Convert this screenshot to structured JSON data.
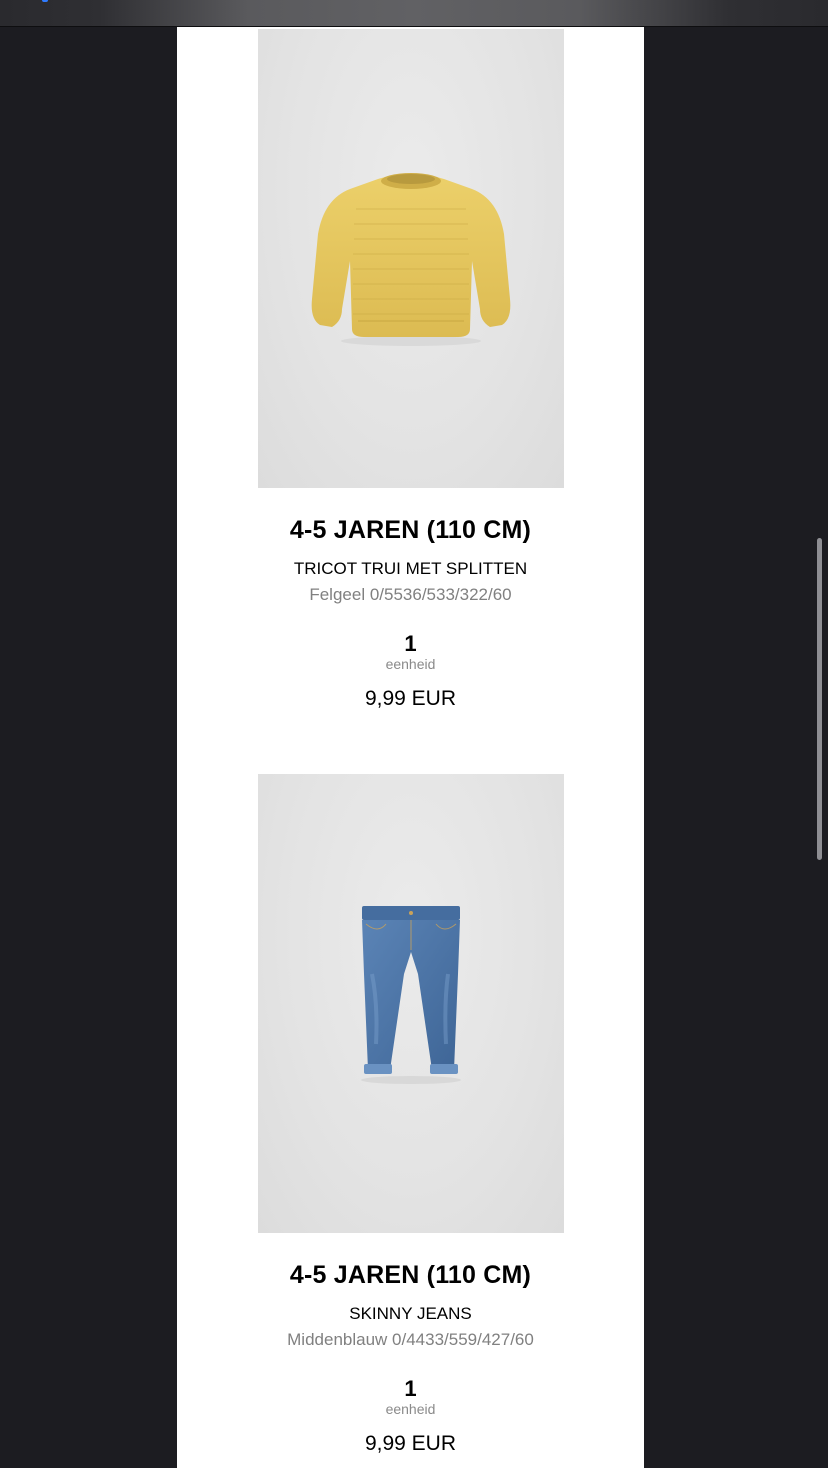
{
  "products": [
    {
      "image_icon": "sweater-image",
      "size": "4-5 JAREN (110 CM)",
      "name": "TRICOT TRUI MET SPLITTEN",
      "color_ref": "Felgeel 0/5536/533/322/60",
      "quantity": "1",
      "unit": "eenheid",
      "price": "9,99 EUR"
    },
    {
      "image_icon": "jeans-image",
      "size": "4-5 JAREN (110 CM)",
      "name": "SKINNY JEANS",
      "color_ref": "Middenblauw 0/4433/559/427/60",
      "quantity": "1",
      "unit": "eenheid",
      "price": "9,99 EUR"
    }
  ],
  "colors": {
    "background": "#1c1c21",
    "email_background": "#ffffff",
    "image_background": "#e3e3e3",
    "sweater": "#e8c95f",
    "jeans": "#4a74a8",
    "muted_text": "#808080"
  }
}
